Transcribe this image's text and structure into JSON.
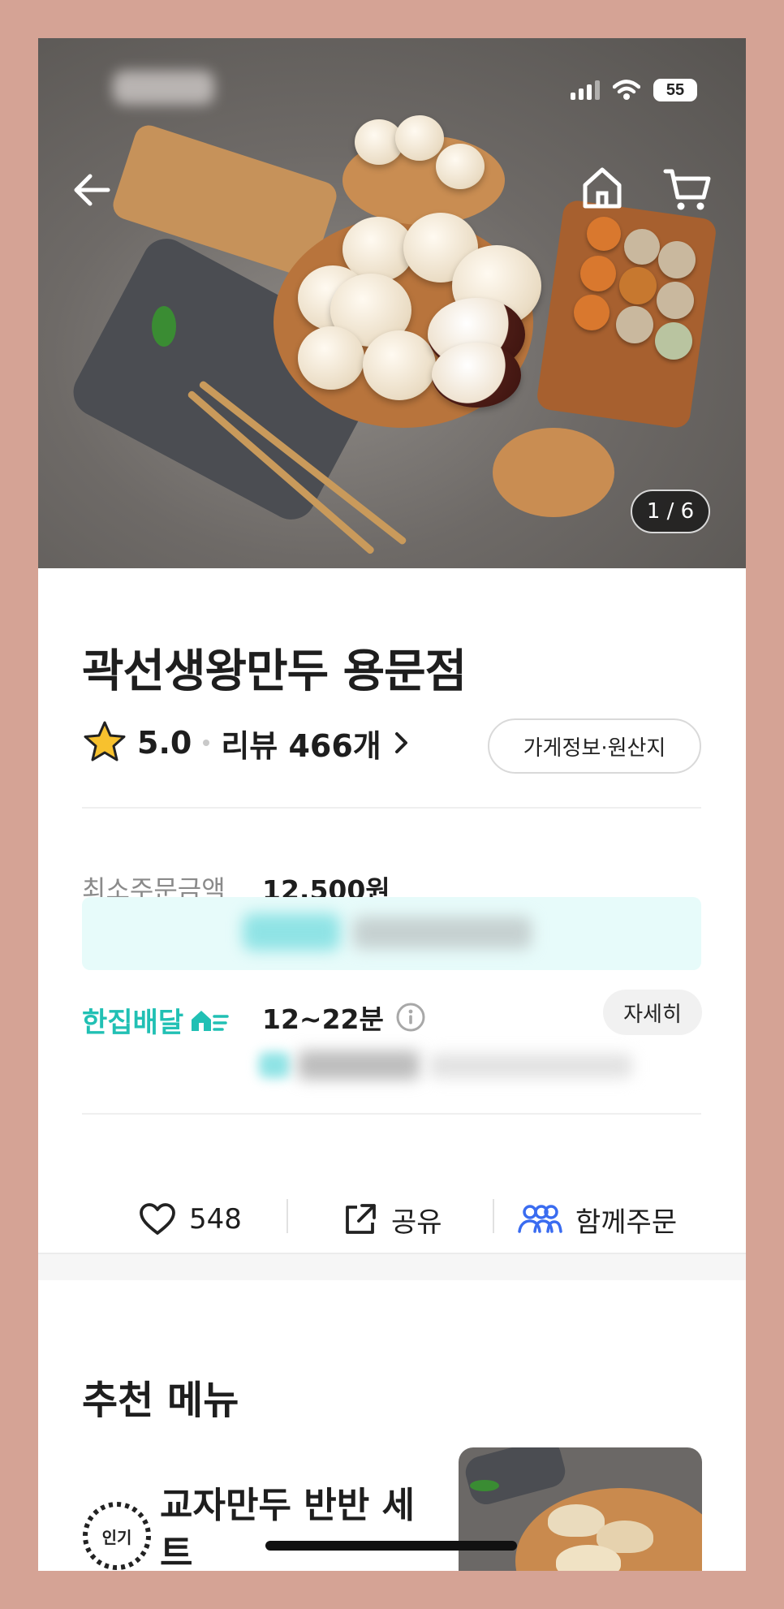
{
  "store": {
    "name": "곽선생왕만두 용문점",
    "rating": "5.0",
    "review_label": "리뷰 466개",
    "info_button": "가게정보·원산지"
  },
  "status_bar": {
    "battery": "55"
  },
  "hero": {
    "counter": "1 / 6"
  },
  "order": {
    "min_label": "최소주문금액",
    "min_amount": "12,500원"
  },
  "delivery": {
    "brand": "한집배달",
    "time": "12~22분",
    "detail_button": "자세히"
  },
  "actions": {
    "like_count": "548",
    "share_label": "공유",
    "group_label": "함께주문"
  },
  "recommended": {
    "title": "추천 메뉴",
    "items": [
      {
        "badge": "인기",
        "name": "교자만두 반반 세트"
      }
    ]
  },
  "colors": {
    "brand_teal": "#21c0b4",
    "group_blue": "#3a6cf0",
    "frame": "#d5a395"
  }
}
